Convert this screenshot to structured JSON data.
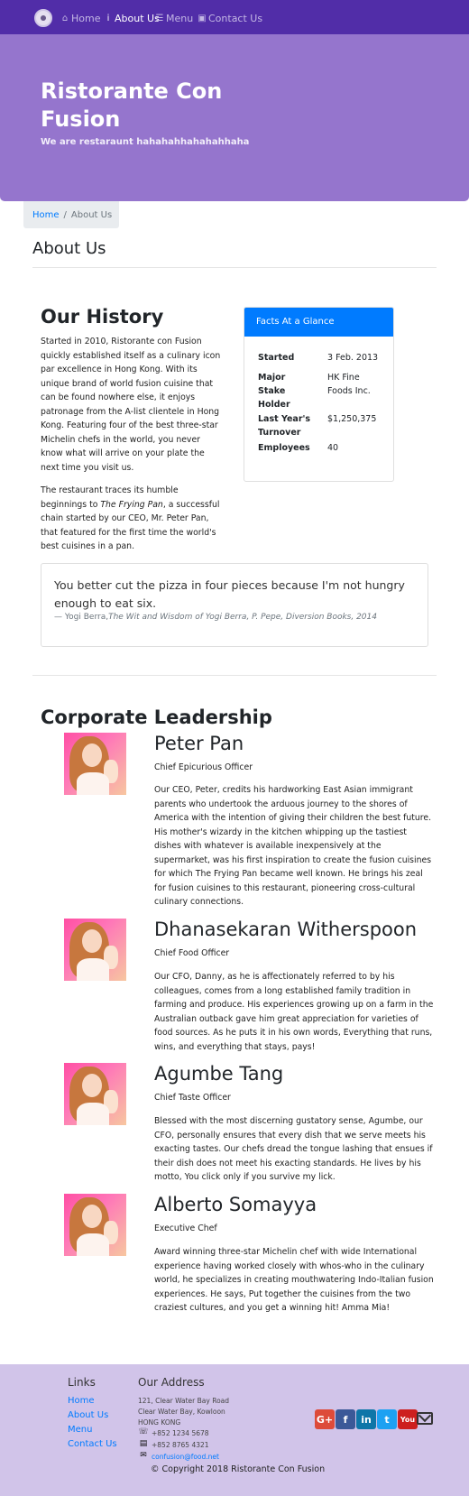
{
  "nav": {
    "items": [
      {
        "icon": "home-icon",
        "label": "Home"
      },
      {
        "icon": "info-icon",
        "label": "About Us"
      },
      {
        "icon": "list-icon",
        "label": "Menu"
      },
      {
        "icon": "address-card-icon",
        "label": "Contact Us"
      }
    ],
    "active": "About Us"
  },
  "jumbotron": {
    "title": "Ristorante Con Fusion",
    "subtitle": "We are restaraunt hahahahhahahahhaha"
  },
  "breadcrumb": {
    "home": "Home",
    "separator": "/",
    "current": "About Us"
  },
  "page_title": "About Us",
  "history": {
    "title": "Our History",
    "paragraph1": "Started in 2010, Ristorante con Fusion quickly established itself as a culinary icon par excellence in Hong Kong. With its unique brand of world fusion cuisine that can be found nowhere else, it enjoys patronage from the A-list clientele in Hong Kong. Featuring four of the best three-star Michelin chefs in the world, you never know what will arrive on your plate the next time you visit us.",
    "paragraph2_before": "The restaurant traces its humble beginnings to ",
    "paragraph2_italic": "The Frying Pan",
    "paragraph2_after": ", a successful chain started by our CEO, Mr. Peter Pan, that featured for the first time the world's best cuisines in a pan."
  },
  "facts": {
    "header": "Facts At a Glance",
    "rows": [
      {
        "label": "Started",
        "value": "3 Feb. 2013"
      },
      {
        "label": "Major Stake Holder",
        "value": "HK Fine Foods Inc."
      },
      {
        "label": "Last Year's Turnover",
        "value": "$1,250,375"
      },
      {
        "label": "Employees",
        "value": "40"
      }
    ]
  },
  "quote": {
    "text": "You better cut the pizza in four pieces because I'm not hungry enough to eat six.",
    "author": "— Yogi Berra,",
    "source": "The Wit and Wisdom of Yogi Berra, P. Pepe, Diversion Books, 2014"
  },
  "leadership": {
    "title": "Corporate Leadership",
    "leaders": [
      {
        "name": "Peter Pan",
        "role": "Chief Epicurious Officer",
        "description": "Our CEO, Peter, credits his hardworking East Asian immigrant parents who undertook the arduous journey to the shores of America with the intention of giving their children the best future. His mother's wizardy in the kitchen whipping up the tastiest dishes with whatever is available inexpensively at the supermarket, was his first inspiration to create the fusion cuisines for which The Frying Pan became well known. He brings his zeal for fusion cuisines to this restaurant, pioneering cross-cultural culinary connections."
      },
      {
        "name": "Dhanasekaran Witherspoon",
        "role": "Chief Food Officer",
        "description": "Our CFO, Danny, as he is affectionately referred to by his colleagues, comes from a long established family tradition in farming and produce. His experiences growing up on a farm in the Australian outback gave him great appreciation for varieties of food sources. As he puts it in his own words, Everything that runs, wins, and everything that stays, pays!"
      },
      {
        "name": "Agumbe Tang",
        "role": "Chief Taste Officer",
        "description": "Blessed with the most discerning gustatory sense, Agumbe, our CFO, personally ensures that every dish that we serve meets his exacting tastes. Our chefs dread the tongue lashing that ensues if their dish does not meet his exacting standards. He lives by his motto, You click only if you survive my lick."
      },
      {
        "name": "Alberto Somayya",
        "role": "Executive Chef",
        "description": "Award winning three-star Michelin chef with wide International experience having worked closely with whos-who in the culinary world, he specializes in creating mouthwatering Indo-Italian fusion experiences. He says, Put together the cuisines from the two craziest cultures, and you get a winning hit! Amma Mia!"
      }
    ]
  },
  "footer": {
    "links_title": "Links",
    "links": [
      "Home",
      "About Us",
      "Menu",
      "Contact Us"
    ],
    "address_title": "Our Address",
    "address_lines": [
      "121, Clear Water Bay Road",
      "Clear Water Bay, Kowloon",
      "HONG KONG"
    ],
    "phone": "+852 1234 5678",
    "fax": "+852 8765 4321",
    "email": "confusion@food.net",
    "social": [
      {
        "icon": "google-plus-icon",
        "label": "G+",
        "color": "#dd4b39"
      },
      {
        "icon": "facebook-icon",
        "label": "f",
        "color": "#3b5998"
      },
      {
        "icon": "linkedin-icon",
        "label": "in",
        "color": "#0e76a8"
      },
      {
        "icon": "twitter-icon",
        "label": "t",
        "color": "#1da1f2"
      },
      {
        "icon": "youtube-icon",
        "label": "You",
        "color": "#cd201f"
      }
    ],
    "copyright": "© Copyright 2018 Ristorante Con Fusion"
  },
  "colors": {
    "navbar": "#512DA8",
    "jumbotron": "#9575CD",
    "footer": "#D1C4E9",
    "accent": "#007bff"
  }
}
